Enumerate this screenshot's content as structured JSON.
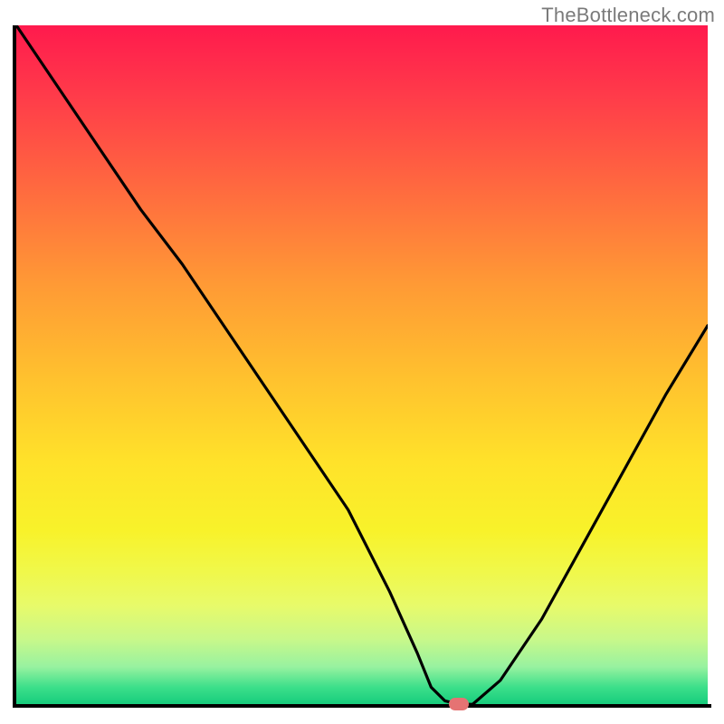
{
  "watermark": "TheBottleneck.com",
  "chart_data": {
    "type": "line",
    "title": "",
    "xlabel": "",
    "ylabel": "",
    "xlim": [
      0,
      100
    ],
    "ylim": [
      0,
      100
    ],
    "grid": false,
    "legend": false,
    "background_gradient": {
      "top_color": "#ff1a4d",
      "mid_color": "#ffe22a",
      "bottom_color": "#10c97a"
    },
    "series": [
      {
        "name": "bottleneck-curve",
        "x": [
          0,
          6,
          12,
          18,
          24,
          30,
          36,
          42,
          48,
          54,
          58,
          60,
          62,
          64,
          66,
          70,
          76,
          82,
          88,
          94,
          100
        ],
        "y": [
          100,
          91,
          82,
          73,
          65,
          56,
          47,
          38,
          29,
          17,
          8,
          3,
          1,
          0.5,
          0.5,
          4,
          13,
          24,
          35,
          46,
          56
        ]
      }
    ],
    "markers": [
      {
        "name": "optimal-point",
        "x": 64,
        "y": 0.5,
        "color": "#e57373"
      }
    ]
  }
}
